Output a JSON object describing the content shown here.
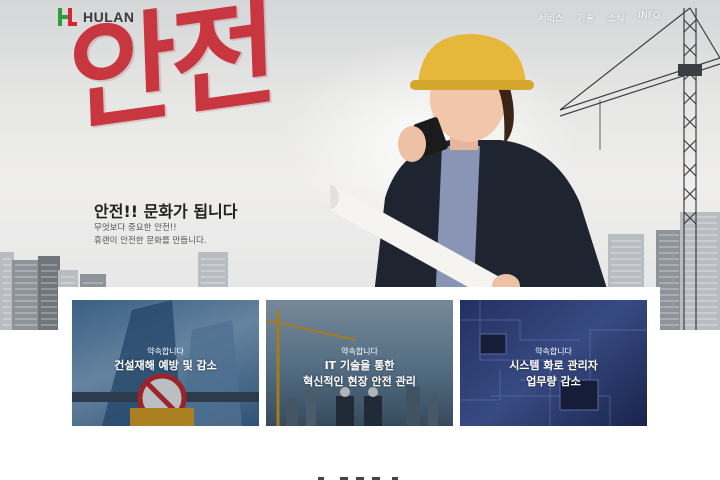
{
  "header": {
    "logo_text": "HULAN",
    "nav": [
      "서비스",
      "기술",
      "소식",
      "INFO"
    ]
  },
  "hero": {
    "calligraphy": "안전",
    "headline": "안전!! 문화가 됩니다",
    "sub_line1": "무엇보다 중요한 안전!!",
    "sub_line2": "휴랜이 안전한 문화를 만듭니다."
  },
  "cards": [
    {
      "small": "약속합니다",
      "title_line1": "건설재해 예방 및 감소",
      "title_line2": ""
    },
    {
      "small": "약속합니다",
      "title_line1": "IT 기술을 통한",
      "title_line2": "혁신적인 현장 안전 관리"
    },
    {
      "small": "약속합니다",
      "title_line1": "시스템 화로 관리자",
      "title_line2": "업무량 감소"
    }
  ],
  "colors": {
    "brand_red": "#c8363f",
    "logo_green": "#2e9b3c",
    "logo_red": "#d8262c"
  }
}
